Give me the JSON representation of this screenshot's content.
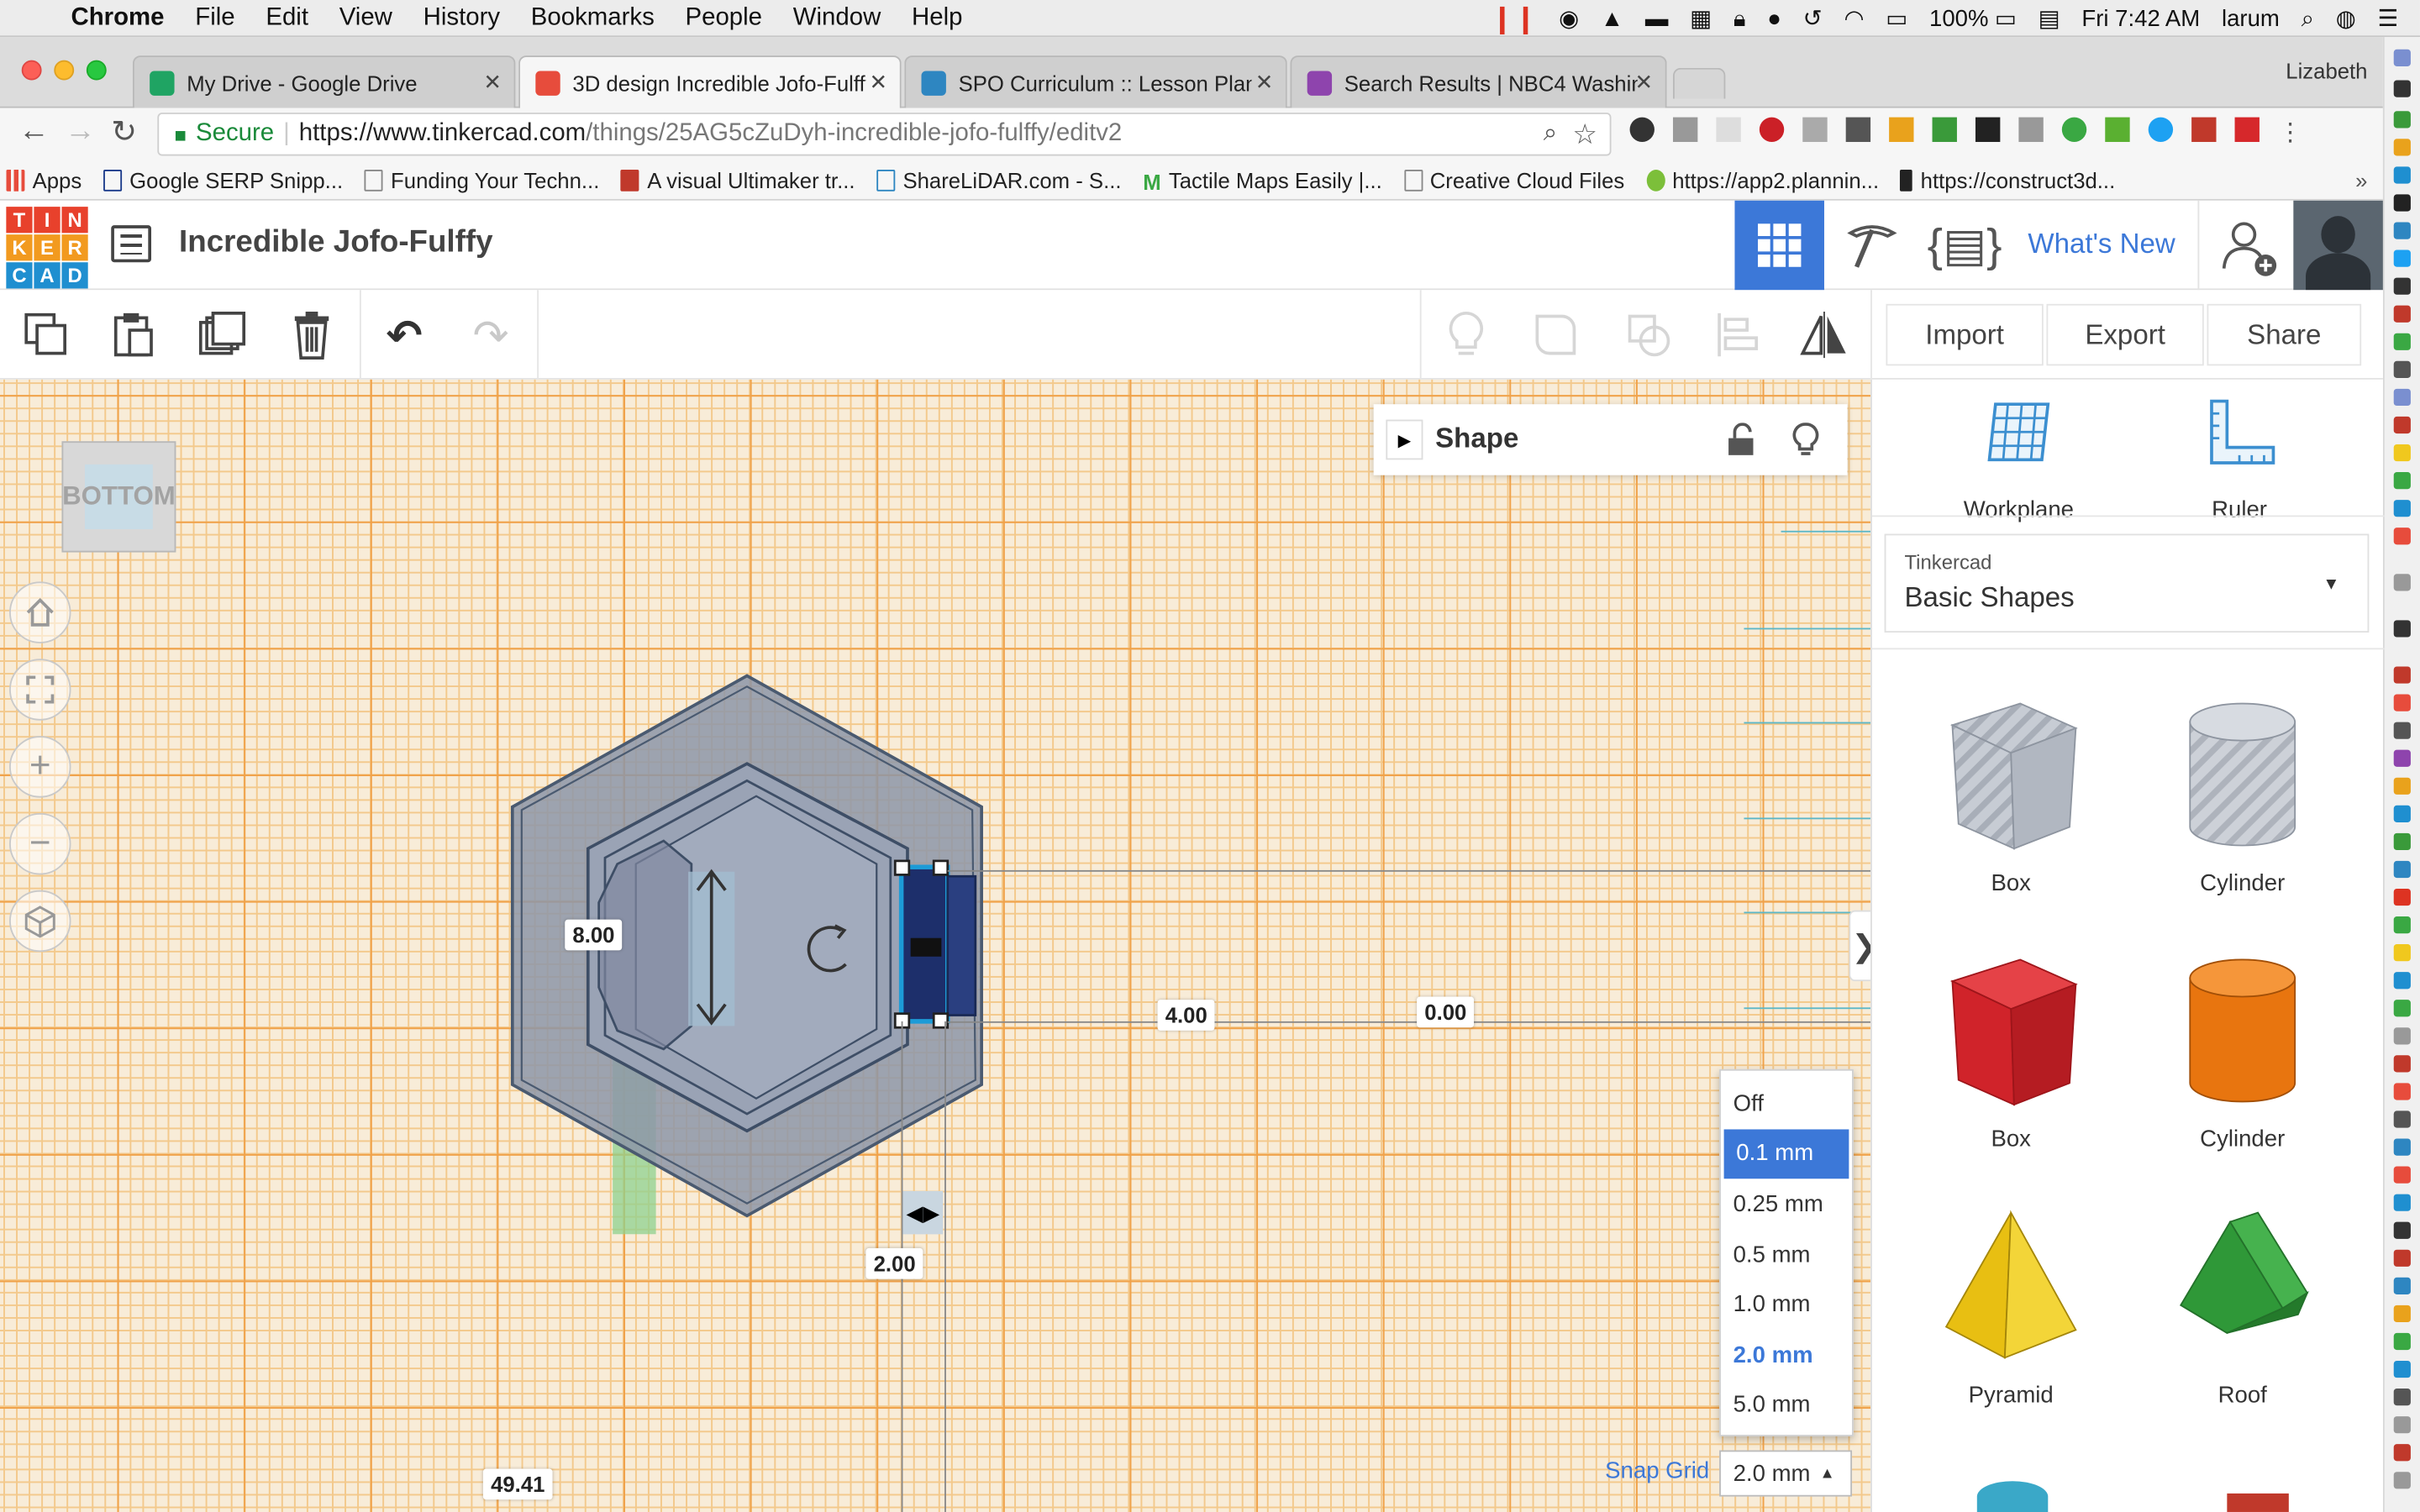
{
  "menubar": {
    "app": "Chrome",
    "menus": [
      "File",
      "Edit",
      "View",
      "History",
      "Bookmarks",
      "People",
      "Window",
      "Help"
    ],
    "battery": "100%",
    "clock": "Fri 7:42 AM",
    "user": "larum"
  },
  "tabs": [
    {
      "label": "My Drive - Google Drive",
      "favicon_color": "#1fa463"
    },
    {
      "label": "3D design Incredible Jofo-Fulffy",
      "favicon_color": "#e74c3c",
      "active": true
    },
    {
      "label": "SPO Curriculum :: Lesson Plan",
      "favicon_color": "#2e86c1"
    },
    {
      "label": "Search Results | NBC4 Washin",
      "favicon_color": "#8e44ad"
    }
  ],
  "profile_name": "Lizabeth",
  "address": {
    "secure_label": "Secure",
    "url_prefix": "https://www.tinkercad.com",
    "url_path": "/things/25AG5cZuDyh-incredible-jofo-fulffy/editv2"
  },
  "bookmarks": [
    "Apps",
    "Google SERP Snipp...",
    "Funding Your Techn...",
    "A visual Ultimaker tr...",
    "ShareLiDAR.com - S...",
    "Tactile Maps Easily |...",
    "Creative Cloud Files",
    "https://app2.plannin...",
    "https://construct3d..."
  ],
  "logo": {
    "letters": [
      "T",
      "I",
      "N",
      "K",
      "E",
      "R",
      "C",
      "A",
      "D"
    ],
    "colors": [
      "#e8412c",
      "#e8412c",
      "#e8412c",
      "#f29a1f",
      "#f29a1f",
      "#f29a1f",
      "#1f8fd0",
      "#1f8fd0",
      "#1f8fd0"
    ]
  },
  "design_title": "Incredible Jofo-Fulffy",
  "header": {
    "whats_new": "What's New"
  },
  "toolbar": {
    "import": "Import",
    "export": "Export",
    "share": "Share"
  },
  "viewcube": {
    "label": "BOTTOM"
  },
  "shape_panel": {
    "title": "Shape"
  },
  "dimensions": {
    "height": "8.00",
    "distance_x": "4.00",
    "distance_origin": "0.00",
    "width": "2.00",
    "position": "49.41"
  },
  "side_tools": {
    "workplane": "Workplane",
    "ruler": "Ruler"
  },
  "library": {
    "source": "Tinkercad",
    "category": "Basic Shapes"
  },
  "shapes": [
    {
      "name": "Box",
      "color": "#b8bec8"
    },
    {
      "name": "Cylinder",
      "color": "#c0c5cd"
    },
    {
      "name": "Box",
      "color": "#d9272e"
    },
    {
      "name": "Cylinder",
      "color": "#ec7a12"
    },
    {
      "name": "Pyramid",
      "color": "#f0c81e"
    },
    {
      "name": "Roof",
      "color": "#3aa843"
    }
  ],
  "snap_grid": {
    "label": "Snap Grid",
    "value": "2.0 mm",
    "options": [
      "Off",
      "0.1 mm",
      "0.25 mm",
      "0.5 mm",
      "1.0 mm",
      "2.0 mm",
      "5.0 mm"
    ],
    "highlighted": "0.1 mm"
  },
  "colors": {
    "accent": "#3c78d8",
    "selection": "#1d9bd7"
  }
}
